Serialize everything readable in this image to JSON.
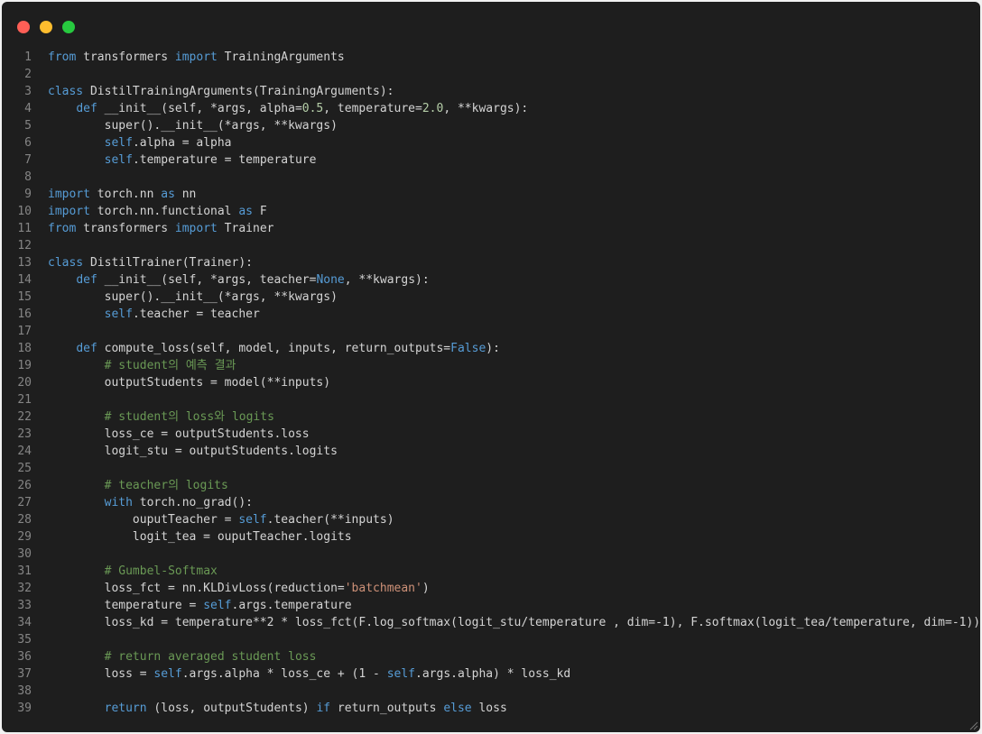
{
  "window": {
    "controls": [
      {
        "name": "close",
        "color": "#ff5f56"
      },
      {
        "name": "minimize",
        "color": "#ffbd2e"
      },
      {
        "name": "maximize",
        "color": "#27c93f"
      }
    ]
  },
  "colors": {
    "background": "#1e1e1e",
    "keyword": "#569cd6",
    "default": "#d4d4d4",
    "number": "#b5cea8",
    "string": "#ce9178",
    "comment": "#6a9955",
    "line_number": "#858585"
  },
  "code_lines": [
    [
      [
        "kw",
        "from"
      ],
      [
        "pl",
        " transformers "
      ],
      [
        "kw",
        "import"
      ],
      [
        "pl",
        " TrainingArguments"
      ]
    ],
    [],
    [
      [
        "kw",
        "class"
      ],
      [
        "pl",
        " DistilTrainingArguments(TrainingArguments):"
      ]
    ],
    [
      [
        "pl",
        "    "
      ],
      [
        "kw",
        "def"
      ],
      [
        "pl",
        " __init__(self, *args, alpha="
      ],
      [
        "num",
        "0.5"
      ],
      [
        "pl",
        ", temperature="
      ],
      [
        "num",
        "2.0"
      ],
      [
        "pl",
        ", **kwargs):"
      ]
    ],
    [
      [
        "pl",
        "        super().__init__(*args, **kwargs)"
      ]
    ],
    [
      [
        "pl",
        "        "
      ],
      [
        "kw",
        "self"
      ],
      [
        "pl",
        ".alpha = alpha"
      ]
    ],
    [
      [
        "pl",
        "        "
      ],
      [
        "kw",
        "self"
      ],
      [
        "pl",
        ".temperature = temperature"
      ]
    ],
    [],
    [
      [
        "kw",
        "import"
      ],
      [
        "pl",
        " torch.nn "
      ],
      [
        "kw",
        "as"
      ],
      [
        "pl",
        " nn"
      ]
    ],
    [
      [
        "kw",
        "import"
      ],
      [
        "pl",
        " torch.nn.functional "
      ],
      [
        "kw",
        "as"
      ],
      [
        "pl",
        " F"
      ]
    ],
    [
      [
        "kw",
        "from"
      ],
      [
        "pl",
        " transformers "
      ],
      [
        "kw",
        "import"
      ],
      [
        "pl",
        " Trainer"
      ]
    ],
    [],
    [
      [
        "kw",
        "class"
      ],
      [
        "pl",
        " DistilTrainer(Trainer):"
      ]
    ],
    [
      [
        "pl",
        "    "
      ],
      [
        "kw",
        "def"
      ],
      [
        "pl",
        " __init__(self, *args, teacher="
      ],
      [
        "kw",
        "None"
      ],
      [
        "pl",
        ", **kwargs):"
      ]
    ],
    [
      [
        "pl",
        "        super().__init__(*args, **kwargs)"
      ]
    ],
    [
      [
        "pl",
        "        "
      ],
      [
        "kw",
        "self"
      ],
      [
        "pl",
        ".teacher = teacher"
      ]
    ],
    [],
    [
      [
        "pl",
        "    "
      ],
      [
        "kw",
        "def"
      ],
      [
        "pl",
        " compute_loss(self, model, inputs, return_outputs="
      ],
      [
        "kw",
        "False"
      ],
      [
        "pl",
        "):"
      ]
    ],
    [
      [
        "pl",
        "        "
      ],
      [
        "cm",
        "# student의 예측 결과"
      ]
    ],
    [
      [
        "pl",
        "        outputStudents = model(**inputs)"
      ]
    ],
    [],
    [
      [
        "pl",
        "        "
      ],
      [
        "cm",
        "# student의 loss와 logits"
      ]
    ],
    [
      [
        "pl",
        "        loss_ce = outputStudents.loss"
      ]
    ],
    [
      [
        "pl",
        "        logit_stu = outputStudents.logits"
      ]
    ],
    [],
    [
      [
        "pl",
        "        "
      ],
      [
        "cm",
        "# teacher의 logits"
      ]
    ],
    [
      [
        "pl",
        "        "
      ],
      [
        "kw",
        "with"
      ],
      [
        "pl",
        " torch.no_grad():"
      ]
    ],
    [
      [
        "pl",
        "            ouputTeacher = "
      ],
      [
        "kw",
        "self"
      ],
      [
        "pl",
        ".teacher(**inputs)"
      ]
    ],
    [
      [
        "pl",
        "            logit_tea = ouputTeacher.logits"
      ]
    ],
    [],
    [
      [
        "pl",
        "        "
      ],
      [
        "cm",
        "# Gumbel-Softmax"
      ]
    ],
    [
      [
        "pl",
        "        loss_fct = nn.KLDivLoss(reduction="
      ],
      [
        "str",
        "'batchmean'"
      ],
      [
        "pl",
        ")"
      ]
    ],
    [
      [
        "pl",
        "        temperature = "
      ],
      [
        "kw",
        "self"
      ],
      [
        "pl",
        ".args.temperature"
      ]
    ],
    [
      [
        "pl",
        "        loss_kd = temperature**2 * loss_fct(F.log_softmax(logit_stu/temperature , dim=-1), F.softmax(logit_tea/temperature, dim=-1))"
      ]
    ],
    [],
    [
      [
        "pl",
        "        "
      ],
      [
        "cm",
        "# return averaged student loss"
      ]
    ],
    [
      [
        "pl",
        "        loss = "
      ],
      [
        "kw",
        "self"
      ],
      [
        "pl",
        ".args.alpha * loss_ce + (1 - "
      ],
      [
        "kw",
        "self"
      ],
      [
        "pl",
        ".args.alpha) * loss_kd"
      ]
    ],
    [],
    [
      [
        "pl",
        "        "
      ],
      [
        "kw",
        "return"
      ],
      [
        "pl",
        " (loss, outputStudents) "
      ],
      [
        "kw",
        "if"
      ],
      [
        "pl",
        " return_outputs "
      ],
      [
        "kw",
        "else"
      ],
      [
        "pl",
        " loss"
      ]
    ]
  ]
}
